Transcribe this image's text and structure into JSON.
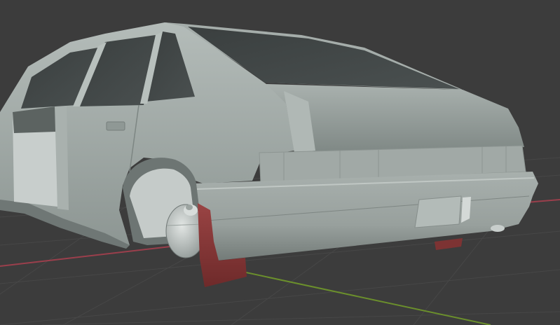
{
  "viewport": {
    "mode": "3d-viewport",
    "background": "#3c3c3c",
    "grid_color": "#4a4a4a",
    "x_axis_color": "#a3414e",
    "y_axis_color": "#6b8f2c"
  },
  "scene": {
    "object": "hatchback-car-body",
    "body_color": "#9aa3a0",
    "glass_color": "#414646",
    "mudflap_color": "#8c3a3a"
  }
}
